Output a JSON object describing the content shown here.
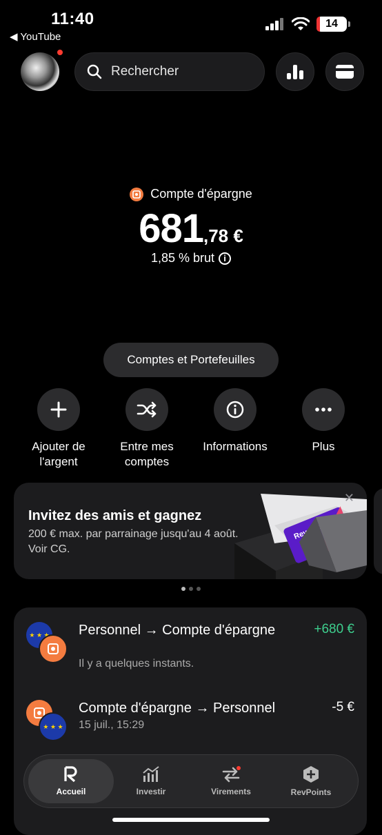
{
  "status_bar": {
    "time": "11:40",
    "back_app": "◀ YouTube",
    "battery": "14"
  },
  "header": {
    "search_placeholder": "Rechercher"
  },
  "balance": {
    "account_label": "Compte d'épargne",
    "integer": "681",
    "decimal": ",78 €",
    "rate": "1,85 % brut"
  },
  "accounts_button": "Comptes et Portefeuilles",
  "actions": [
    {
      "label": "Ajouter de\nl'argent",
      "icon": "plus-icon"
    },
    {
      "label": "Entre mes\ncomptes",
      "icon": "shuffle-icon"
    },
    {
      "label": "Informations",
      "icon": "info-icon"
    },
    {
      "label": "Plus",
      "icon": "more-icon"
    }
  ],
  "promo": {
    "title": "Invitez des amis et gagnez",
    "subtitle": "200 € max. par parrainage jusqu'au 4 août. Voir CG.",
    "card_brand": "Revolut",
    "carousel_pages": 3,
    "carousel_active": 1
  },
  "transactions": [
    {
      "title": "Personnel → Compte d'épargne",
      "subtitle": "Il y a quelques instants.",
      "amount": "+680 €",
      "amount_color": "#3ecf8e"
    },
    {
      "title": "Compte d'épargne → Personnel",
      "subtitle": "15 juil., 15:29",
      "amount": "-5 €",
      "amount_color": "#ffffff"
    }
  ],
  "nav": [
    {
      "label": "Accueil",
      "icon": "revolut-r-icon",
      "active": true
    },
    {
      "label": "Investir",
      "icon": "investment-chart-icon",
      "active": false
    },
    {
      "label": "Virements",
      "icon": "transfer-arrows-icon",
      "active": false,
      "badge": true
    },
    {
      "label": "RevPoints",
      "icon": "revpoints-hexagon-icon",
      "active": false
    }
  ],
  "colors": {
    "accent_orange": "#f47c40",
    "positive": "#3ecf8e",
    "badge_red": "#ff3b30"
  }
}
